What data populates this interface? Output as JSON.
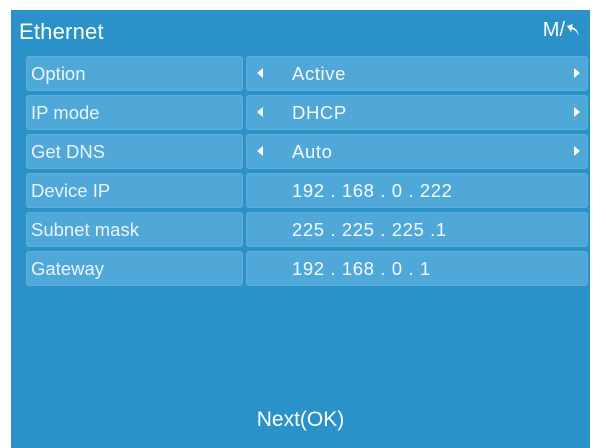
{
  "header": {
    "title": "Ethernet",
    "menu_back_label": "M/"
  },
  "rows": [
    {
      "label": "Option",
      "value": "Active",
      "has_arrows": true
    },
    {
      "label": "IP mode",
      "value": "DHCP",
      "has_arrows": true
    },
    {
      "label": "Get DNS",
      "value": "Auto",
      "has_arrows": true
    },
    {
      "label": "Device IP",
      "value": "192 . 168 . 0 . 222",
      "has_arrows": false
    },
    {
      "label": "Subnet mask",
      "value": "225 . 225 . 225 .1",
      "has_arrows": false
    },
    {
      "label": "Gateway",
      "value": "192 . 168 . 0 . 1",
      "has_arrows": false
    }
  ],
  "footer": {
    "next_label": "Next(OK)"
  },
  "colors": {
    "background": "#2a92c9",
    "cell": "#4fa8d8",
    "text": "#ffffff"
  },
  "icons": {
    "back": "back-arrow-icon",
    "prev": "triangle-left-icon",
    "next": "triangle-right-icon"
  }
}
